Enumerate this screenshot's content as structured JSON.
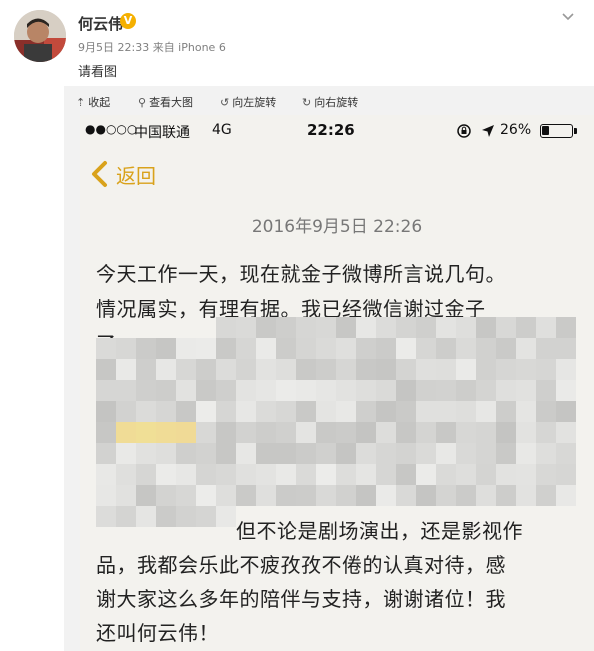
{
  "post": {
    "author": "何云伟",
    "verified_mark": "V",
    "meta": "9月5日 22:33 来自 iPhone 6",
    "text": "请看图"
  },
  "toolbar": {
    "collapse": "收起",
    "view_large": "查看大图",
    "rotate_left": "向左旋转",
    "rotate_right": "向右旋转"
  },
  "phone": {
    "status": {
      "signal": "●●○○○",
      "carrier": "中国联通",
      "network": "4G",
      "time": "22:26",
      "battery": "26%",
      "battery_level": 0.26
    },
    "nav": {
      "back_label": "返回"
    },
    "message": {
      "date": "2016年9月5日 22:26",
      "lines": [
        "今天工作一天，现在就金子微博所言说几句。",
        "情况属实，有理有据。我已经微信谢过金子",
        "了。"
      ],
      "tail_lines": [
        "但不论是剧场演出，还是影视作",
        "品，我都会乐此不疲孜孜不倦的认真对待，感",
        "谢大家这么多年的陪伴与支持，谢谢诸位！我",
        "还叫何云伟！"
      ]
    }
  },
  "colors": {
    "accent_gold": "#d9a21b",
    "verified": "#f5b000",
    "toolbar_bg": "#f2f2f2",
    "screen_bg": "#f3f2ee"
  }
}
